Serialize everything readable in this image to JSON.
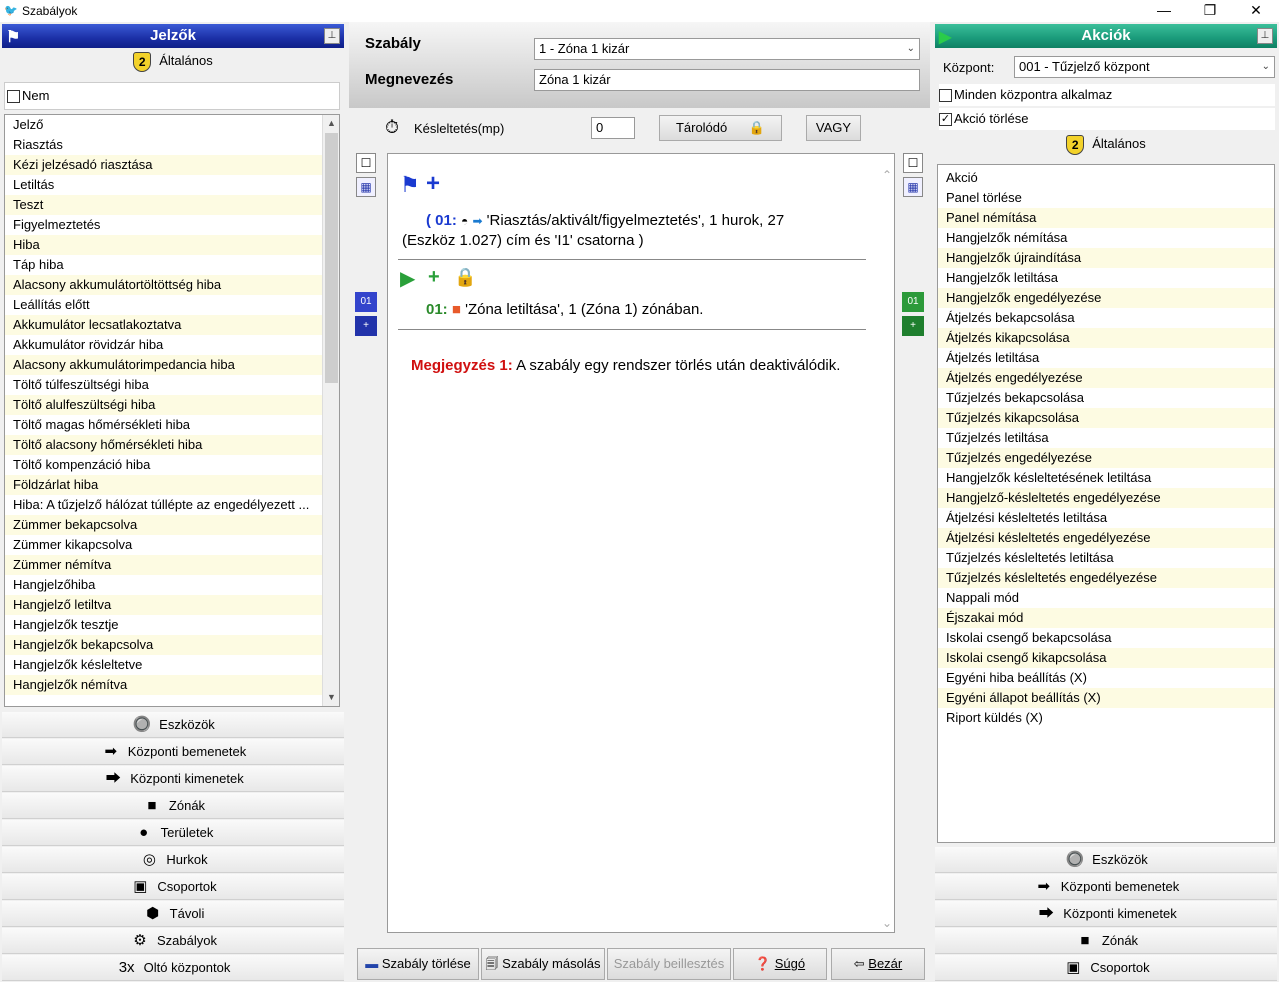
{
  "window": {
    "title": "Szabályok",
    "minimize": "—",
    "maximize": "❐",
    "close": "✕"
  },
  "left": {
    "header": "Jelzők",
    "general_label": "Általános",
    "badge": "2",
    "nem_label": "Nem",
    "list": [
      "Jelző",
      "Riasztás",
      "Kézi jelzésadó riasztása",
      "Letiltás",
      "Teszt",
      "Figyelmeztetés",
      "Hiba",
      "Táp hiba",
      "Alacsony akkumulátortöltöttség hiba",
      "Leállítás előtt",
      "Akkumulátor lecsatlakoztatva",
      "Akkumulátor rövidzár hiba",
      "Alacsony akkumulátorimpedancia hiba",
      "Töltő túlfeszültségi hiba",
      "Töltő alulfeszültségi hiba",
      "Töltő magas hőmérsékleti hiba",
      "Töltő alacsony hőmérsékleti hiba",
      "Töltő kompenzáció hiba",
      "Földzárlat hiba",
      "Hiba: A tűzjelző hálózat túllépte az engedélyezett ...",
      "Zümmer bekapcsolva",
      "Zümmer kikapcsolva",
      "Zümmer némítva",
      "Hangjelzőhiba",
      "Hangjelző letiltva",
      "Hangjelzők tesztje",
      "Hangjelzők bekapcsolva",
      "Hangjelzők késleltetve",
      "Hangjelzők némítva"
    ],
    "nav": [
      {
        "label": "Eszközök",
        "icon": "🔘"
      },
      {
        "label": "Központi bemenetek",
        "icon": "➡"
      },
      {
        "label": "Központi kimenetek",
        "icon": "⮕"
      },
      {
        "label": "Zónák",
        "icon": "■"
      },
      {
        "label": "Területek",
        "icon": "●"
      },
      {
        "label": "Hurkok",
        "icon": "◎"
      },
      {
        "label": "Csoportok",
        "icon": "▣"
      },
      {
        "label": "Távoli",
        "icon": "⬢"
      },
      {
        "label": "Szabályok",
        "icon": "⚙"
      },
      {
        "label": "Oltó központok",
        "icon": "3x"
      }
    ]
  },
  "mid": {
    "rule_label": "Szabály",
    "rule_value": "1 - Zóna 1 kizár",
    "name_label": "Megnevezés",
    "name_value": "Zóna 1 kizár",
    "delay_label": "Késleltetés(mp)",
    "delay_value": "0",
    "latch_button": "Tárolódó",
    "or_button": "VAGY",
    "seq_left": "01",
    "seq_right": "01",
    "plus": "+",
    "cond_prefix": "( 01:",
    "cond_text1": "'Riasztás/aktivált/figyelmeztetés', 1 hurok, 27",
    "cond_text2": "(Eszköz 1.027) cím és 'I1' csatorna )",
    "action_prefix": "01:",
    "action_text": "'Zóna letiltása', 1 (Zóna 1) zónában.",
    "note_label": "Megjegyzés 1:",
    "note_text": "A szabály egy rendszer törlés után deaktiválódik.",
    "buttons": {
      "delete": "Szabály törlése",
      "copy": "Szabály másolás",
      "paste": "Szabály beillesztés",
      "help": "Súgó",
      "close": "Bezár"
    }
  },
  "right": {
    "header": "Akciók",
    "central_label": "Központ:",
    "central_value": "001 - Tűzjelző központ",
    "apply_all": "Minden központra alkalmaz",
    "delete_action": "Akció törlése",
    "general_label": "Általános",
    "badge": "2",
    "list": [
      "Akció",
      "Panel törlése",
      "Panel némítása",
      "Hangjelzők némítása",
      "Hangjelzők újraindítása",
      "Hangjelzők letiltása",
      "Hangjelzők engedélyezése",
      "Átjelzés bekapcsolása",
      "Átjelzés kikapcsolása",
      "Átjelzés letiltása",
      "Átjelzés engedélyezése",
      "Tűzjelzés bekapcsolása",
      "Tűzjelzés kikapcsolása",
      "Tűzjelzés letiltása",
      "Tűzjelzés engedélyezése",
      "Hangjelzők késleltetésének letiltása",
      "Hangjelző-késleltetés engedélyezése",
      "Átjelzési késleltetés letiltása",
      "Átjelzési késleltetés engedélyezése",
      "Tűzjelzés késleltetés letiltása",
      "Tűzjelzés késleltetés engedélyezése",
      "Nappali mód",
      "Éjszakai mód",
      "Iskolai csengő bekapcsolása",
      "Iskolai csengő kikapcsolása",
      "Egyéni hiba beállítás (X)",
      "Egyéni állapot beállítás (X)",
      "Riport küldés (X)"
    ],
    "nav": [
      {
        "label": "Eszközök",
        "icon": "🔘"
      },
      {
        "label": "Központi bemenetek",
        "icon": "➡"
      },
      {
        "label": "Központi kimenetek",
        "icon": "⮕"
      },
      {
        "label": "Zónák",
        "icon": "■"
      },
      {
        "label": "Csoportok",
        "icon": "▣"
      }
    ]
  }
}
